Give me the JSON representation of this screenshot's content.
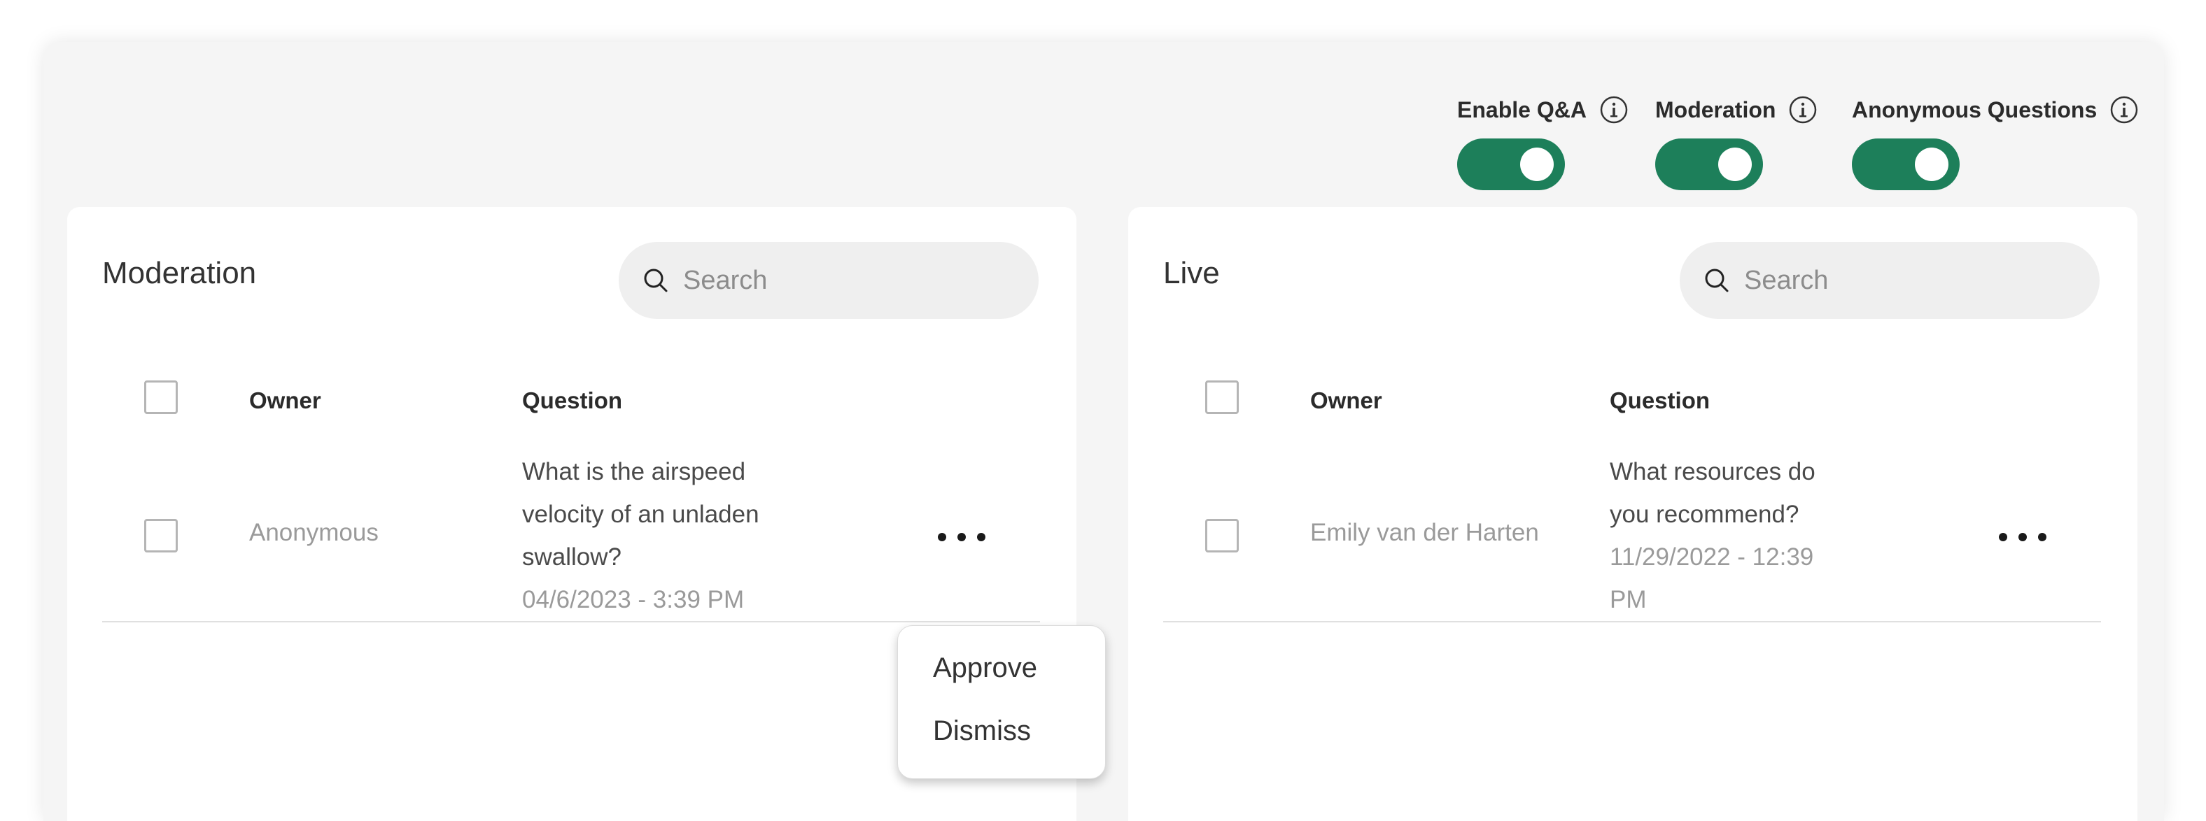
{
  "settings": [
    {
      "label": "Enable Q&A",
      "enabled": true,
      "info_icon": "info-icon"
    },
    {
      "label": "Moderation",
      "enabled": true,
      "info_icon": "info-icon"
    },
    {
      "label": "Anonymous Questions",
      "enabled": true,
      "info_icon": "info-icon"
    }
  ],
  "colors": {
    "toggle_on": "#1d7f5a",
    "background": "#f5f5f5",
    "panel": "#ffffff"
  },
  "moderation_panel": {
    "title": "Moderation",
    "search_placeholder": "Search",
    "columns": {
      "owner": "Owner",
      "question": "Question"
    },
    "rows": [
      {
        "owner": "Anonymous",
        "question_lines": [
          "What is the airspeed",
          "velocity of an unladen",
          "swallow?"
        ],
        "date": "04/6/2023 - 3:39 PM"
      }
    ]
  },
  "live_panel": {
    "title": "Live",
    "search_placeholder": "Search",
    "columns": {
      "owner": "Owner",
      "question": "Question"
    },
    "rows": [
      {
        "owner": "Emily van der Harten",
        "question_lines": [
          "What resources do",
          "you recommend?"
        ],
        "date_lines": [
          "11/29/2022 - 12:39",
          "PM"
        ]
      }
    ]
  },
  "context_menu": {
    "items": [
      "Approve",
      "Dismiss"
    ]
  }
}
